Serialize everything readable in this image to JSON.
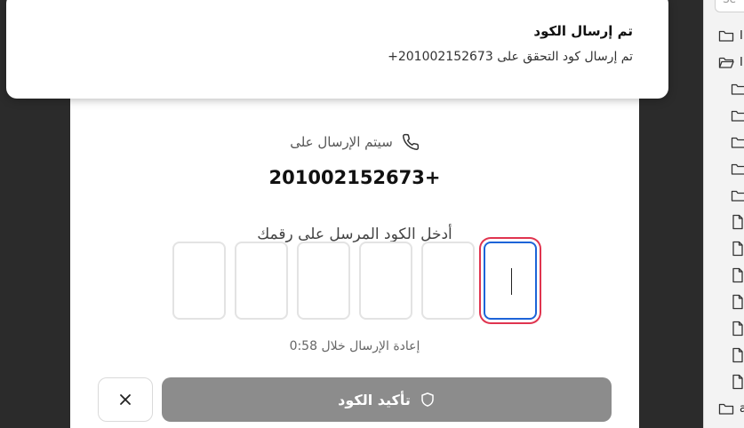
{
  "toast": {
    "title": "تم إرسال الكود",
    "body": "تم إرسال كود التحقق على 201002152673+"
  },
  "verify": {
    "send_to_label": "سيتم الإرسال على",
    "phone_number": "201002152673+",
    "enter_code_label": "أدخل الكود المرسل على رقمك",
    "otp_digits": [
      "",
      "",
      "",
      "",
      "",
      ""
    ],
    "resend_text": "إعادة الإرسال خلال 0:58",
    "confirm_label": "تأكيد الكود",
    "colors": {
      "active_border": "#1d64d8",
      "focus_ring": "#e0344f",
      "confirm_disabled": "#8c8c8c"
    }
  },
  "sidebar": {
    "search_placeholder": "Se",
    "items": [
      {
        "type": "folder",
        "label": "Ⅰ"
      },
      {
        "type": "folder-open",
        "label": "Ⅰ"
      },
      {
        "type": "folder",
        "label": ""
      },
      {
        "type": "folder",
        "label": ""
      },
      {
        "type": "folder",
        "label": ""
      },
      {
        "type": "folder",
        "label": ""
      },
      {
        "type": "folder",
        "label": ""
      },
      {
        "type": "file",
        "label": ""
      },
      {
        "type": "file",
        "label": ""
      },
      {
        "type": "file",
        "label": ""
      },
      {
        "type": "file",
        "label": ""
      },
      {
        "type": "file",
        "label": ""
      },
      {
        "type": "file",
        "label": ""
      },
      {
        "type": "file",
        "label": ""
      },
      {
        "type": "folder",
        "label": "a"
      }
    ]
  }
}
